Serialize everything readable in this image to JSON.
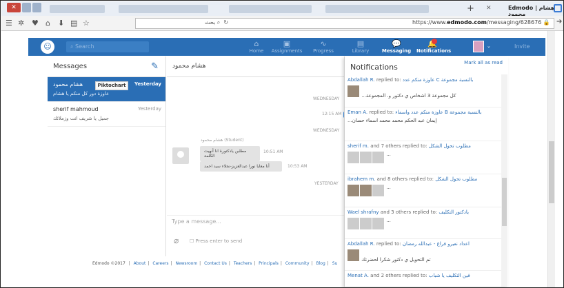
{
  "browser": {
    "tab_title": "Edmodo | هشام محمود",
    "url_prefix": "https://www.",
    "url_domain": "edmodo.com",
    "url_path": "/messaging/628676",
    "search_text": "بحث"
  },
  "appbar": {
    "search_placeholder": "Search",
    "nav": [
      {
        "label": "Home",
        "icon": "⌂"
      },
      {
        "label": "Assignments",
        "icon": "▣"
      },
      {
        "label": "Progress",
        "icon": "∿"
      },
      {
        "label": "Library",
        "icon": "▤"
      },
      {
        "label": "Messaging",
        "icon": "💬"
      },
      {
        "label": "Notifications",
        "icon": "🔔"
      }
    ],
    "invite": "Invite"
  },
  "messages": {
    "title": "Messages",
    "conversations": [
      {
        "name": "هشام محمود",
        "time": "Yesterday",
        "preview": "عاوزة دور كل منكم يا هشام"
      },
      {
        "name": "sherif mahmoud",
        "time": "Yesterday",
        "preview": "جميل يا شريف انت وزملائك"
      }
    ]
  },
  "chat": {
    "title": "هشام محمود",
    "image_label": "Piktochart",
    "day1": "WEDNESDAY",
    "time1": "12:15 AM",
    "day2": "WEDNESDAY",
    "sender": "هشام محمود (Student)",
    "bubble1": "مطلبن يادكتورة انا أنهيت الكلمة",
    "bubble1_time": "10:51 AM",
    "bubble2": "أنا معايا نورا عبدالعزيز-نجلاء سيد احمد",
    "bubble2_time": "10:53 AM",
    "day3": "YESTERDAY",
    "placeholder": "Type a message...",
    "press_enter": "Press enter to send"
  },
  "notifications": {
    "title": "Notifications",
    "mark_all": "Mark all as read",
    "items": [
      {
        "who": "Abdallah R.",
        "action": "replied to:",
        "group": "عاوزة منكم عدد C بالنسبة مجموعة",
        "body": "...كل مجموعة 3 اشخاص ي دكتور و. المجموعة"
      },
      {
        "who": "Eman A.",
        "action": "replied to:",
        "group": "عاوزة منكم عدد واسماء B بالنسبة مجموعة",
        "body": "...إيمان عبد الحكم محمد محمد اسماء حسان"
      },
      {
        "who": "sherif m.",
        "action": "and 7 others replied to:",
        "group": "مطلوب تحول الشكل",
        "body": ""
      },
      {
        "who": "ibrahem m.",
        "action": "and 8 others replied to:",
        "group": "مطلوب تحول الشكل",
        "body": ""
      },
      {
        "who": "Wael shrafny",
        "action": "and 3 others replied to:",
        "group": "يادكتور التكليف",
        "body": ""
      },
      {
        "who": "Abdallah R.",
        "action": "replied to:",
        "group": "اعداد نعيرو فراغ - عبدالله رمضان",
        "body": "تم التحويل ي دكتور شكرا لحضرتك"
      },
      {
        "who": "Menat A.",
        "action": "and 2 others replied to:",
        "group": "فين التكليف يا شباب",
        "body": ""
      }
    ],
    "more": "..."
  },
  "footer": {
    "copyright": "Edmodo ©2017",
    "links": [
      "About",
      "Careers",
      "Newsroom",
      "Contact Us",
      "Teachers",
      "Principals",
      "Community",
      "Blog",
      "Su"
    ]
  },
  "colors": {
    "brand": "#2a6eb5",
    "badge": "#e23b3b"
  }
}
